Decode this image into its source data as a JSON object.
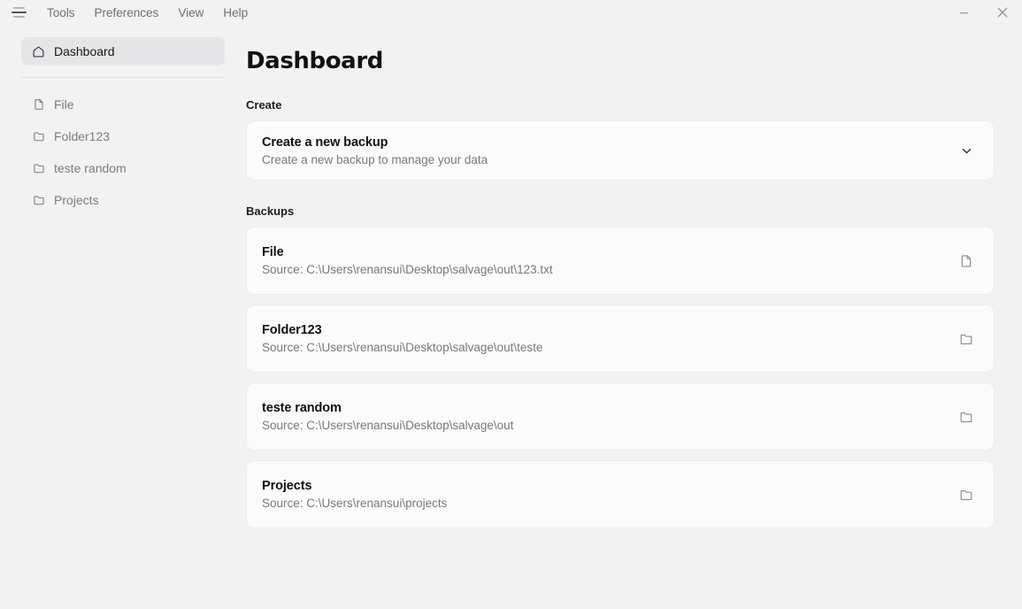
{
  "titlebar": {
    "menu_icon": "hamburger-icon",
    "menu_items": [
      {
        "label": "Tools"
      },
      {
        "label": "Preferences"
      },
      {
        "label": "View"
      },
      {
        "label": "Help"
      }
    ],
    "window_controls": [
      {
        "name": "minimize",
        "glyph": "minimize-icon"
      },
      {
        "name": "close",
        "glyph": "close-icon"
      }
    ]
  },
  "sidebar": {
    "primary": {
      "label": "Dashboard",
      "icon": "home-icon",
      "active": true
    },
    "items": [
      {
        "label": "File",
        "icon": "file-icon"
      },
      {
        "label": "Folder123",
        "icon": "folder-icon"
      },
      {
        "label": "teste random",
        "icon": "folder-icon"
      },
      {
        "label": "Projects",
        "icon": "folder-icon"
      }
    ]
  },
  "main": {
    "title": "Dashboard",
    "create": {
      "label": "Create",
      "card": {
        "title": "Create a new backup",
        "subtitle": "Create a new backup to manage your data",
        "action_icon": "chevron-down-icon"
      }
    },
    "backups": {
      "label": "Backups",
      "items": [
        {
          "title": "File",
          "subtitle": "Source: C:\\Users\\renansui\\Desktop\\salvage\\out\\123.txt",
          "action_icon": "file-icon"
        },
        {
          "title": "Folder123",
          "subtitle": "Source: C:\\Users\\renansui\\Desktop\\salvage\\out\\teste",
          "action_icon": "folder-icon"
        },
        {
          "title": "teste random",
          "subtitle": "Source: C:\\Users\\renansui\\Desktop\\salvage\\out",
          "action_icon": "folder-icon"
        },
        {
          "title": "Projects",
          "subtitle": "Source: C:\\Users\\renansui\\projects",
          "action_icon": "folder-icon"
        }
      ]
    }
  },
  "colors": {
    "app_background": "#f2f2f2",
    "card_background": "#fbfbfb",
    "card_border": "#ededef",
    "active_nav_background": "#e6e6e8",
    "muted_text": "#78787f",
    "primary_text": "#111111"
  }
}
